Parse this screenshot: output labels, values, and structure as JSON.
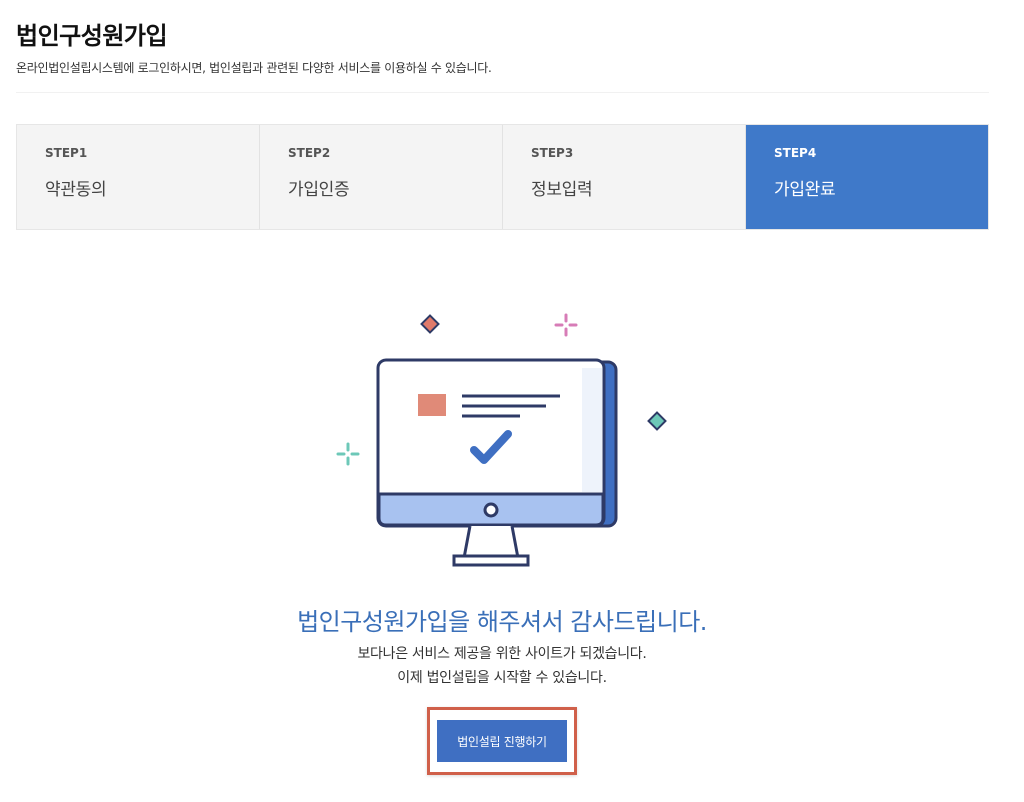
{
  "header": {
    "title": "법인구성원가입",
    "subtitle": "온라인법인설립시스템에 로그인하시면, 법인설립과 관련된 다양한 서비스를 이용하실 수 있습니다."
  },
  "steps": [
    {
      "num": "STEP1",
      "label": "약관동의",
      "active": false
    },
    {
      "num": "STEP2",
      "label": "가입인증",
      "active": false
    },
    {
      "num": "STEP3",
      "label": "정보입력",
      "active": false
    },
    {
      "num": "STEP4",
      "label": "가입완료",
      "active": true
    }
  ],
  "completion": {
    "illustration_icon": "monitor-checkmark-icon",
    "title": "법인구성원가입을 해주셔서 감사드립니다.",
    "line1": "보다나은 서비스 제공을 위한 사이트가 되겠습니다.",
    "line2": "이제 법인설립을 시작할 수 있습니다.",
    "button_label": "법인설립 진행하기"
  },
  "colors": {
    "accent": "#3f79c9",
    "button": "#3f6fc2",
    "highlight_border": "#d0604a",
    "title_text": "#3a6fb8"
  }
}
